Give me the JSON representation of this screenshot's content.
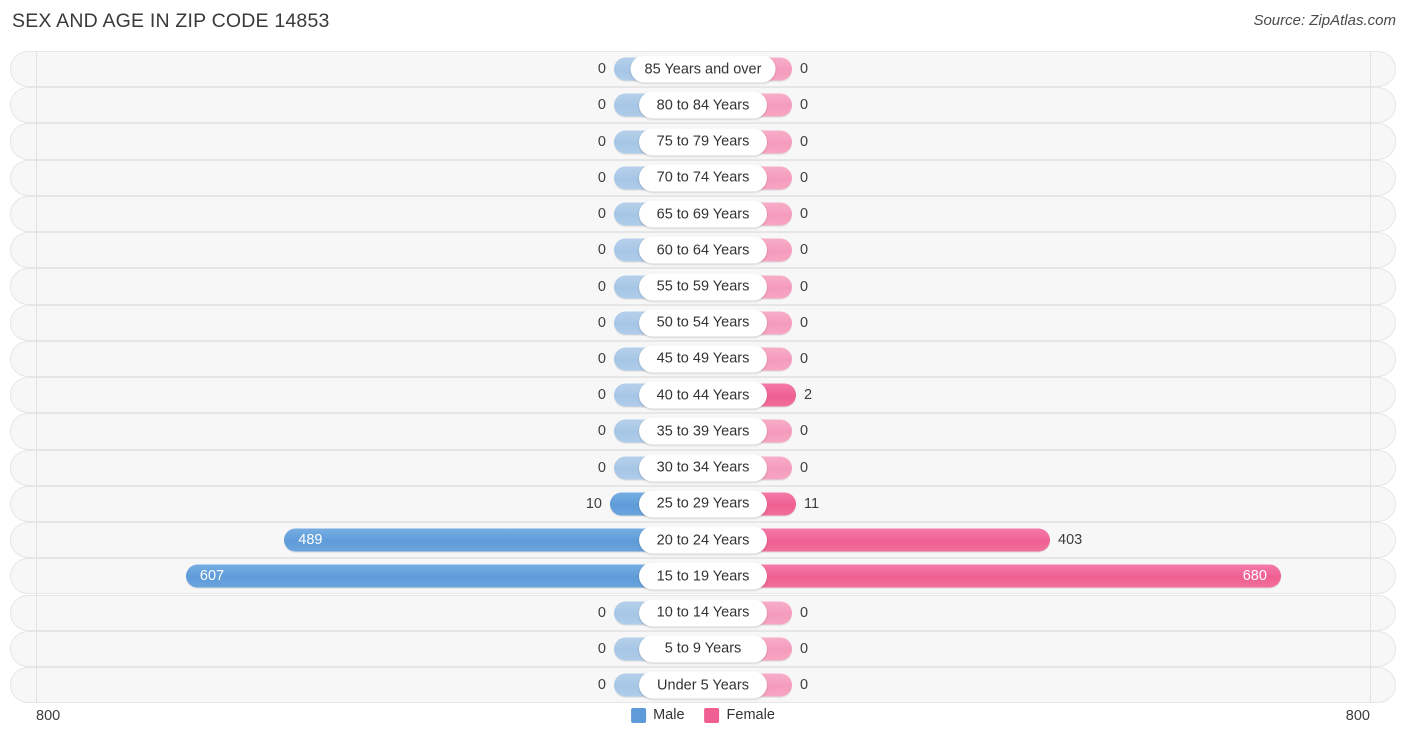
{
  "header": {
    "title": "SEX AND AGE IN ZIP CODE 14853",
    "source": "Source: ZipAtlas.com"
  },
  "legend": {
    "male_label": "Male",
    "female_label": "Female",
    "male_color": "#5e9bd8",
    "female_color": "#ef5f92"
  },
  "axis": {
    "left_end": "800",
    "right_end": "800"
  },
  "chart_data": {
    "type": "bar",
    "subtype": "population-pyramid",
    "title": "SEX AND AGE IN ZIP CODE 14853",
    "xlabel": "",
    "ylabel": "",
    "xlim": [
      800,
      800
    ],
    "axis_max": 800,
    "grid": false,
    "legend_position": "bottom-center",
    "categories": [
      "85 Years and over",
      "80 to 84 Years",
      "75 to 79 Years",
      "70 to 74 Years",
      "65 to 69 Years",
      "60 to 64 Years",
      "55 to 59 Years",
      "50 to 54 Years",
      "45 to 49 Years",
      "40 to 44 Years",
      "35 to 39 Years",
      "30 to 34 Years",
      "25 to 29 Years",
      "20 to 24 Years",
      "15 to 19 Years",
      "10 to 14 Years",
      "5 to 9 Years",
      "Under 5 Years"
    ],
    "series": [
      {
        "name": "Male",
        "color": "#5e9bd8",
        "values": [
          0,
          0,
          0,
          0,
          0,
          0,
          0,
          0,
          0,
          0,
          0,
          0,
          10,
          489,
          607,
          0,
          0,
          0
        ]
      },
      {
        "name": "Female",
        "color": "#ef5f92",
        "values": [
          0,
          0,
          0,
          0,
          0,
          0,
          0,
          0,
          0,
          2,
          0,
          0,
          11,
          403,
          680,
          0,
          0,
          0
        ]
      }
    ]
  }
}
